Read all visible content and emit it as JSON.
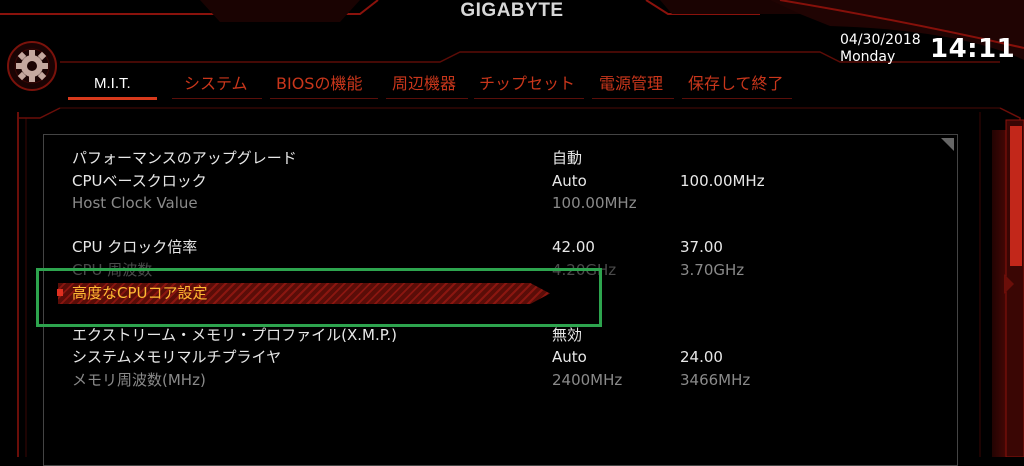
{
  "header": {
    "brand": "GIGABYTE",
    "date": "04/30/2018",
    "day": "Monday",
    "time": "14:11"
  },
  "tabs": [
    {
      "label": "M.I.T.",
      "active": true
    },
    {
      "label": "システム",
      "active": false
    },
    {
      "label": "BIOSの機能",
      "active": false
    },
    {
      "label": "周辺機器",
      "active": false
    },
    {
      "label": "チップセット",
      "active": false
    },
    {
      "label": "電源管理",
      "active": false
    },
    {
      "label": "保存して終了",
      "active": false
    }
  ],
  "settings": [
    {
      "label": "パフォーマンスのアップグレード",
      "value": "自動",
      "extra": ""
    },
    {
      "label": "CPUベースクロック",
      "value": "Auto",
      "extra": "100.00MHz"
    },
    {
      "label": "Host Clock Value",
      "value": "100.00MHz",
      "extra": ""
    },
    {
      "label": "CPU クロック倍率",
      "value": "42.00",
      "extra": "37.00"
    },
    {
      "label": "CPU 周波数",
      "value": "4.20GHz",
      "extra": "3.70GHz"
    },
    {
      "label": "高度なCPUコア設定",
      "value": "",
      "extra": ""
    },
    {
      "label": "エクストリーム・メモリ・プロファイル(X.M.P.)",
      "value": "無効",
      "extra": ""
    },
    {
      "label": "システムメモリマルチプライヤ",
      "value": "Auto",
      "extra": "24.00"
    },
    {
      "label": "メモリ周波数(MHz)",
      "value": "2400MHz",
      "extra": "3466MHz"
    }
  ],
  "colors": {
    "accent": "#d83a1c",
    "tab_inactive": "#c9361b",
    "selected_text": "#ffbb33",
    "highlight_box": "#2da44e"
  },
  "icons": [
    "gear-icon",
    "panel-corner-icon",
    "scroll-arrow-icon"
  ]
}
